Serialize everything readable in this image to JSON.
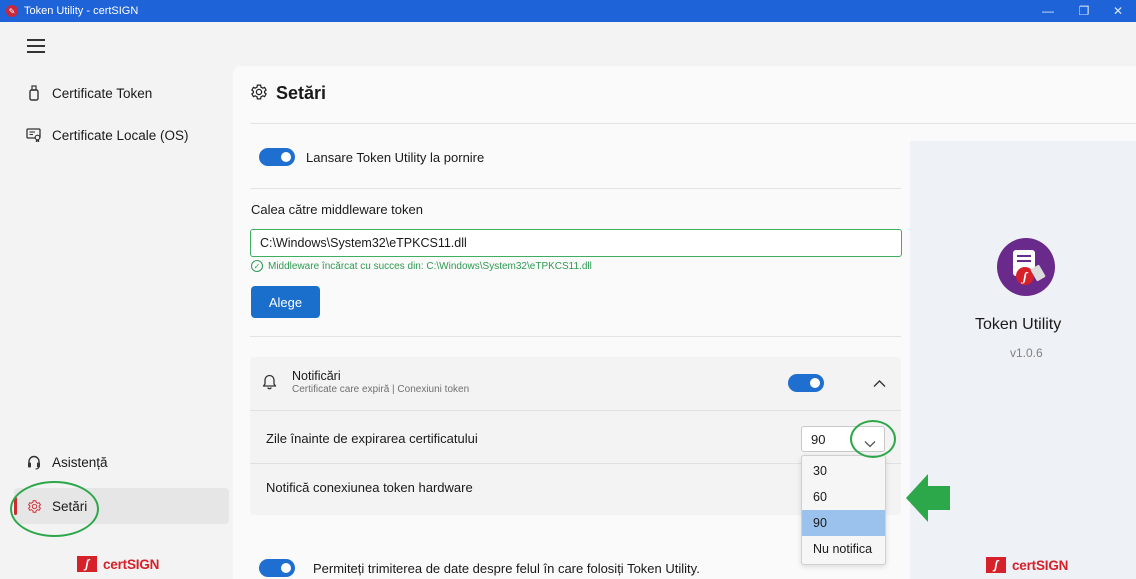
{
  "window": {
    "title": "Token Utility - certSIGN",
    "app_icon": "certsign-app-icon"
  },
  "sidebar": {
    "items": [
      {
        "label": "Certificate Token",
        "icon": "usb-token-icon"
      },
      {
        "label": "Certificate Locale (OS)",
        "icon": "certificate-icon"
      },
      {
        "label": "Asistență",
        "icon": "headset-icon"
      },
      {
        "label": "Setări",
        "icon": "gear-icon",
        "active": true
      }
    ],
    "brand": "certSIGN"
  },
  "settings": {
    "title": "Setări",
    "launch_at_startup": {
      "label": "Lansare Token Utility la pornire",
      "enabled": true
    },
    "middleware": {
      "label": "Calea către middleware token",
      "value": "C:\\Windows\\System32\\eTPKCS11.dll",
      "status": "Middleware încărcat cu succes din: C:\\Windows\\System32\\eTPKCS11.dll",
      "button": "Alege"
    },
    "notifications": {
      "title": "Notificări",
      "subtitle": "Certificate care expiră | Conexiuni token",
      "enabled": true,
      "expiry_days_label": "Zile înainte de expirarea certificatului",
      "expiry_days_value": "90",
      "expiry_days_options": [
        "30",
        "60",
        "90",
        "Nu notifica"
      ],
      "selected_option": "90",
      "hardware_connection_label": "Notifică conexiunea token hardware"
    },
    "telemetry": {
      "label": "Permiteți trimiterea de date despre felul în care folosiți Token Utility.",
      "enabled": true
    }
  },
  "about": {
    "app_name": "Token Utility",
    "version": "v1.0.6",
    "brand": "certSIGN"
  },
  "colors": {
    "accent": "#1f6fd1",
    "brand": "#d6202a",
    "success": "#2f9a53",
    "annotation": "#2ca84a"
  }
}
